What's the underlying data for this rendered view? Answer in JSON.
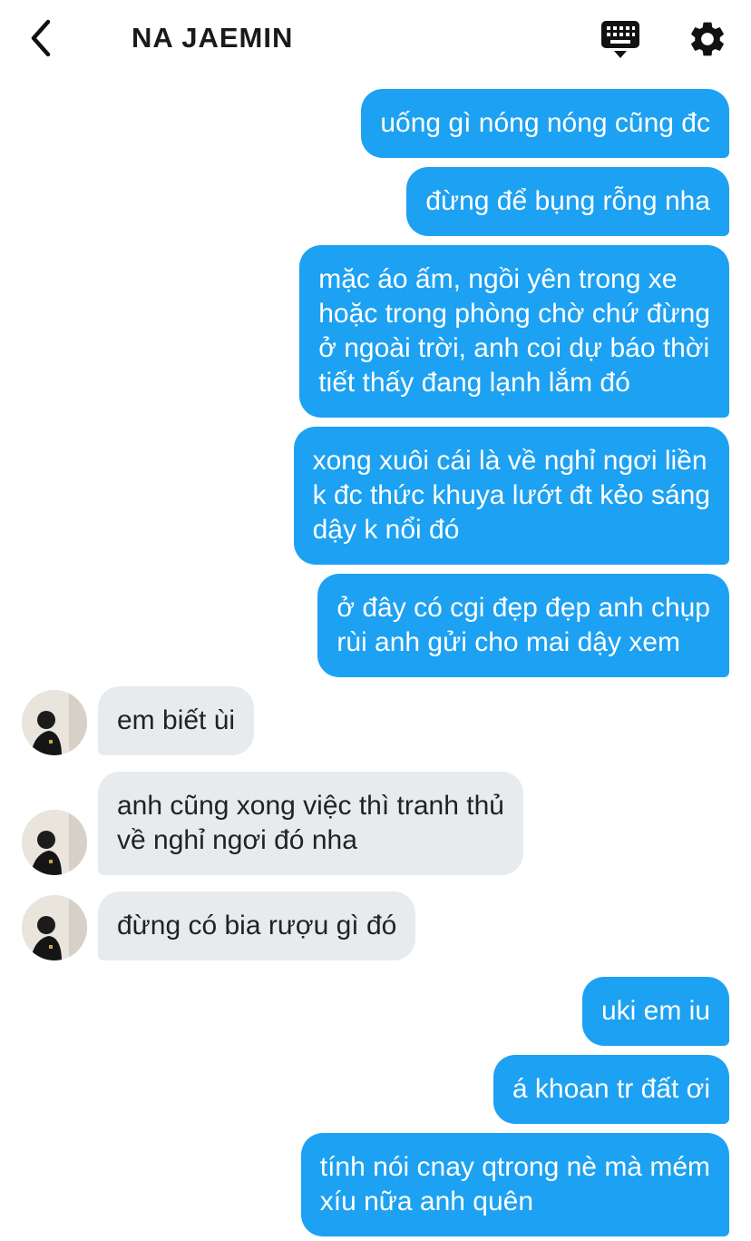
{
  "header": {
    "title": "NA JAEMIN",
    "back_icon": "chevron-left-icon",
    "keyboard_icon": "keyboard-icon",
    "settings_icon": "gear-icon"
  },
  "colors": {
    "outgoing_bubble": "#1da1f2",
    "incoming_bubble": "#e7ebee",
    "outgoing_text": "#ffffff",
    "incoming_text": "#222222"
  },
  "messages": [
    {
      "direction": "outgoing",
      "lines": [
        "uống gì nóng nóng cũng đc"
      ]
    },
    {
      "direction": "outgoing",
      "lines": [
        "đừng để bụng rỗng nha"
      ]
    },
    {
      "direction": "outgoing",
      "lines": [
        "mặc áo ấm, ngồi yên trong xe",
        "hoặc trong phòng chờ chứ đừng",
        "ở ngoài trời, anh coi dự báo thời",
        "tiết thấy đang lạnh lắm đó"
      ]
    },
    {
      "direction": "outgoing",
      "lines": [
        "xong xuôi cái là về nghỉ ngơi liền",
        "k đc thức khuya lướt đt kẻo sáng",
        "dậy k nổi đó"
      ]
    },
    {
      "direction": "outgoing",
      "lines": [
        "ở đây có cgi đẹp đẹp anh chụp",
        "rùi anh gửi cho mai dậy xem"
      ]
    },
    {
      "direction": "incoming",
      "lines": [
        "em biết ùi"
      ]
    },
    {
      "direction": "incoming",
      "lines": [
        "anh cũng xong việc thì tranh thủ",
        "về nghỉ ngơi đó nha"
      ]
    },
    {
      "direction": "incoming",
      "lines": [
        "đừng có bia rượu gì đó"
      ]
    },
    {
      "direction": "outgoing",
      "lines": [
        "uki em iu"
      ]
    },
    {
      "direction": "outgoing",
      "lines": [
        "á khoan tr đất ơi"
      ]
    },
    {
      "direction": "outgoing",
      "lines": [
        "tính nói cnay qtrong nè mà mém",
        "xíu nữa anh quên"
      ]
    }
  ]
}
